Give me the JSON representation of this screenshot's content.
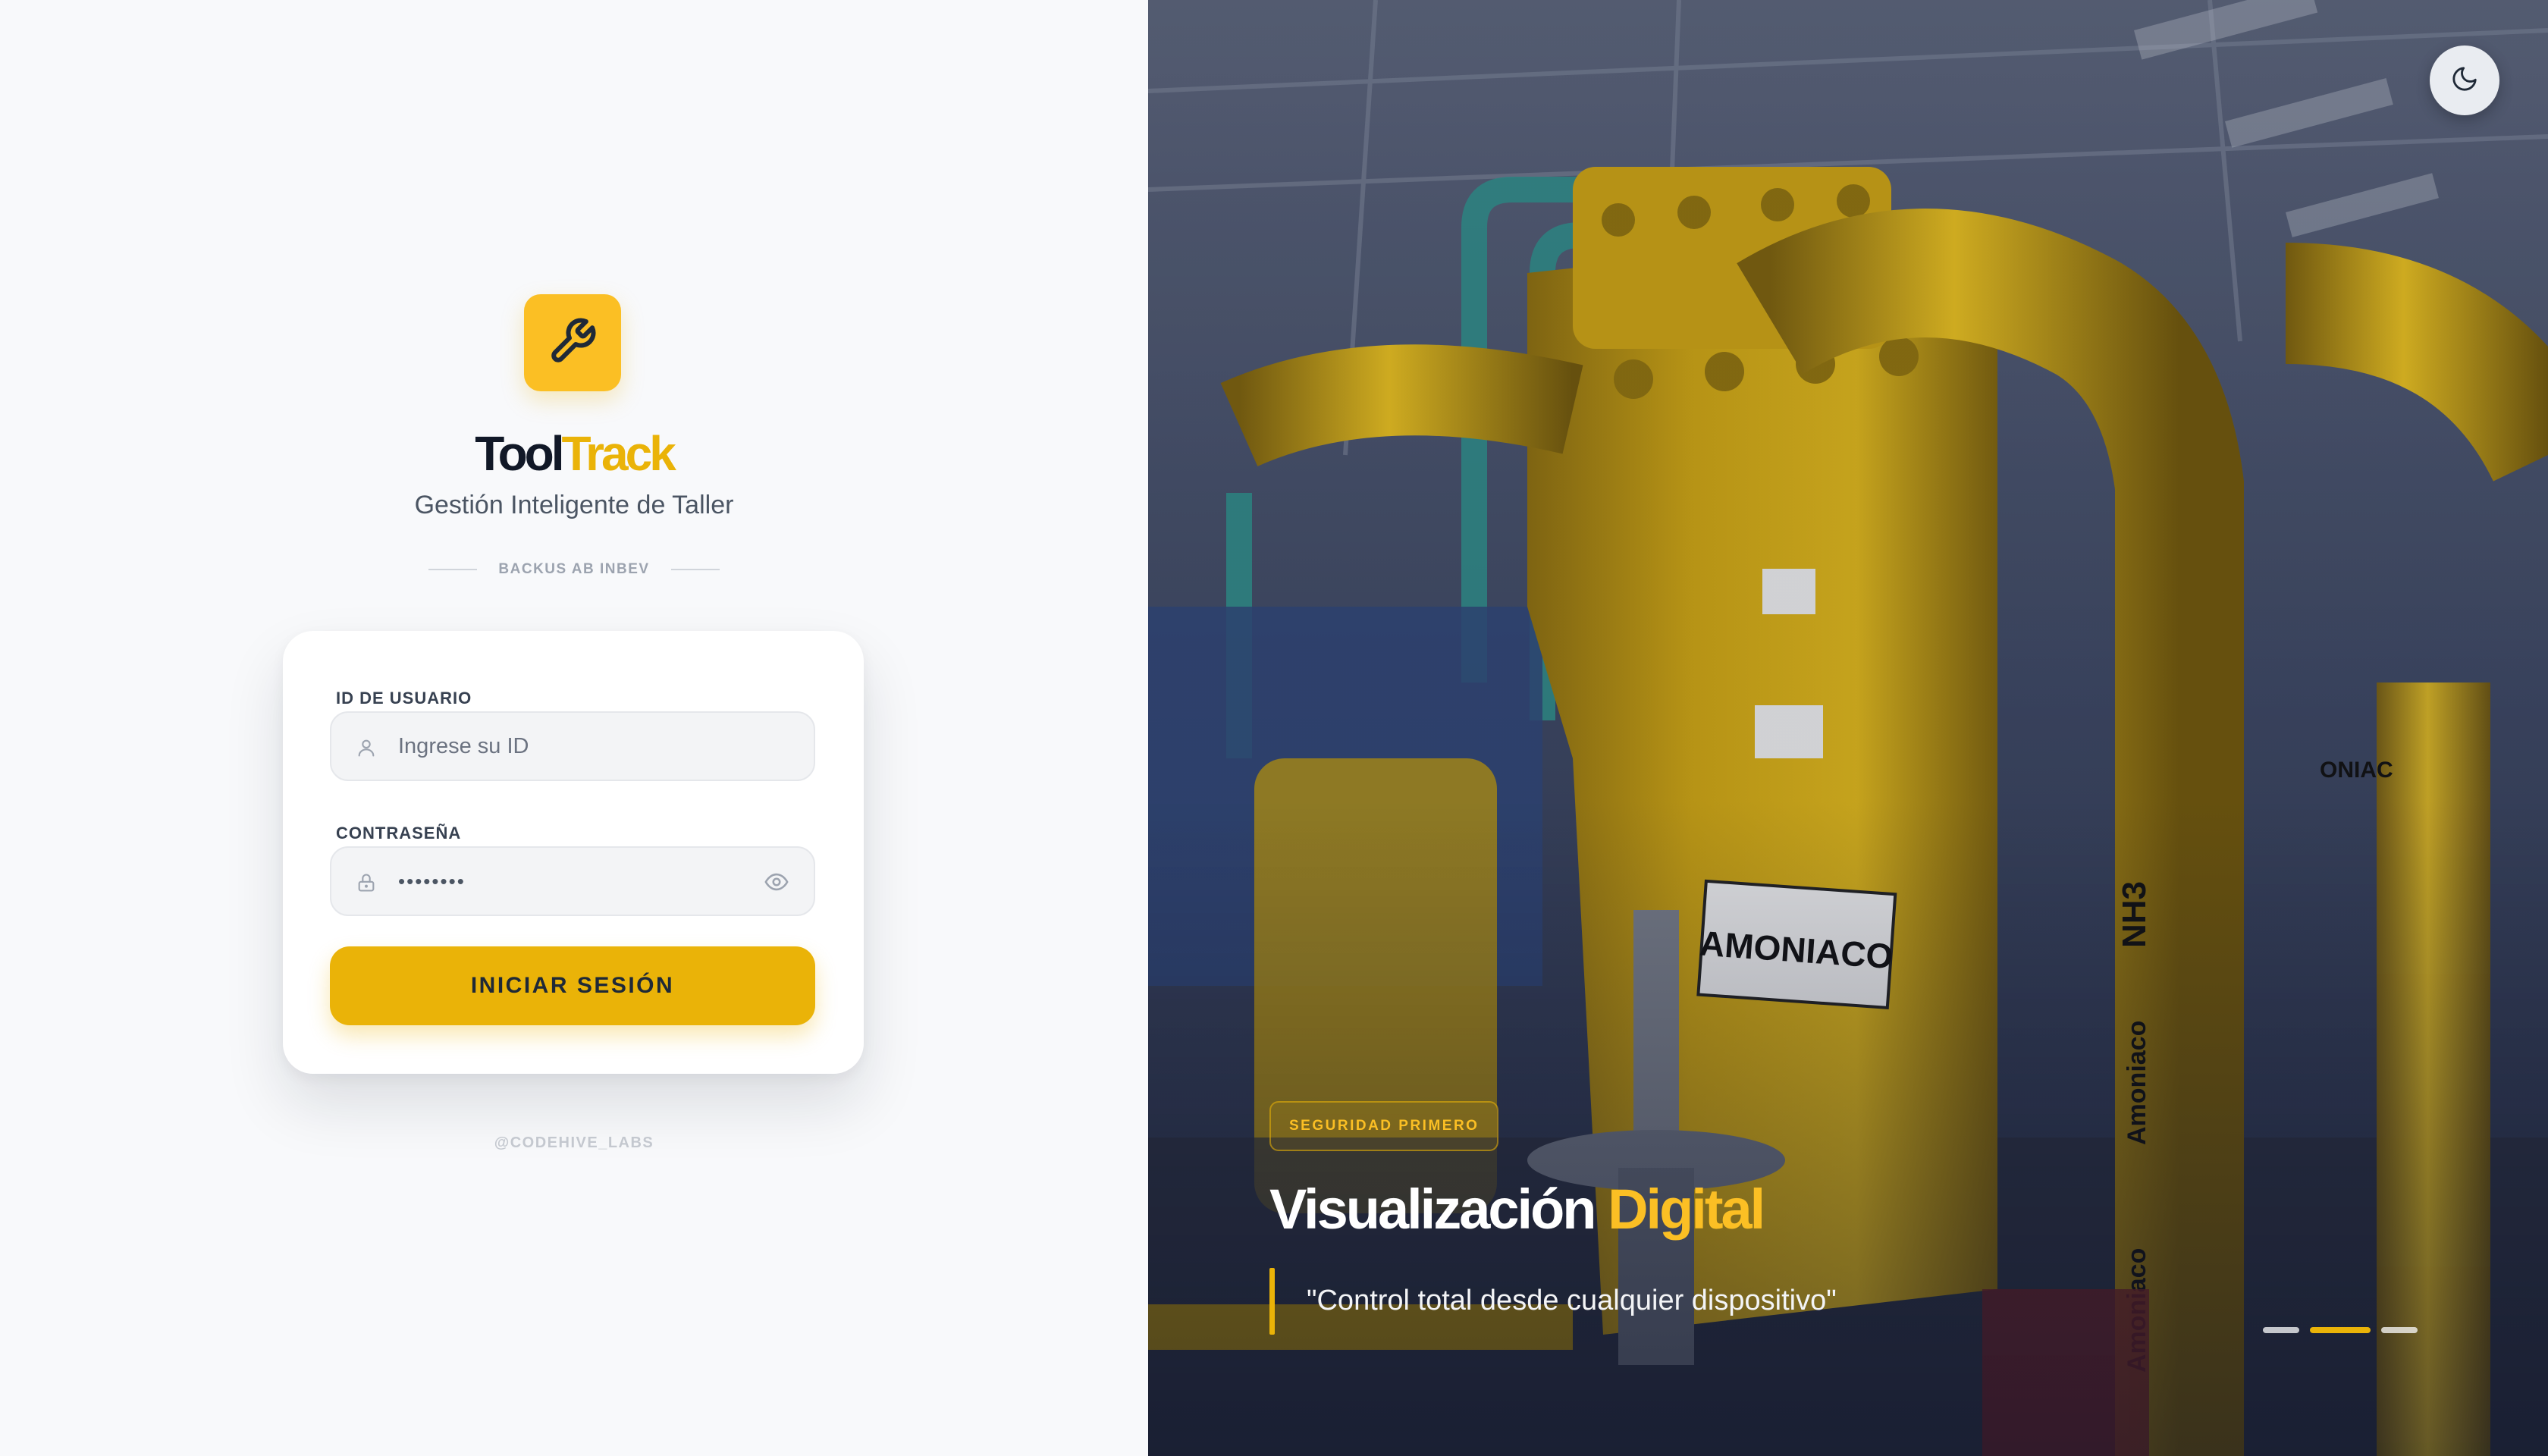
{
  "brand": {
    "name_part1": "Tool",
    "name_part2": "Track",
    "tagline": "Gestión Inteligente de Taller",
    "company": "BACKUS AB INBEV",
    "logo_icon": "wrench-icon",
    "accent_color": "#eab308"
  },
  "login": {
    "user_label": "ID DE USUARIO",
    "user_placeholder": "Ingrese su ID",
    "password_label": "CONTRASEÑA",
    "password_value": "••••••••",
    "submit_label": "INICIAR SESIÓN",
    "icons": {
      "user": "user-icon",
      "password": "lock-icon",
      "toggle": "eye-icon"
    }
  },
  "footer": {
    "credit": "@CODEHIVE_LABS"
  },
  "hero": {
    "badge": "SEGURIDAD PRIMERO",
    "title_part1": "Visualización",
    "title_part2": "Digital",
    "quote": "\"Control total desde cualquier dispositivo\"",
    "theme_toggle_icon": "moon-icon",
    "slides_total": 3,
    "active_slide": 2,
    "image_labels": [
      "AMONIACO",
      "NH3",
      "Amoniaco",
      "Amoniaco",
      "ONIAC"
    ]
  }
}
